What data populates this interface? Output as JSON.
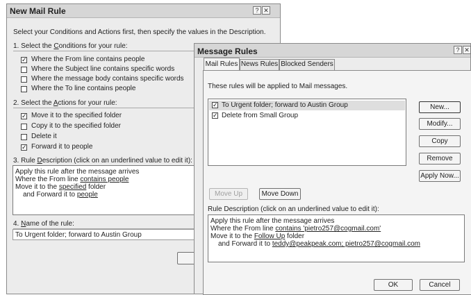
{
  "new_rule": {
    "title": "New Mail Rule",
    "instruction": "Select your Conditions and Actions first, then specify the values in the Description.",
    "step1": {
      "pre": "1. Select the ",
      "u": "C",
      "post": "onditions for your rule:"
    },
    "conditions": [
      {
        "label": "Where the From line contains people",
        "checked": true
      },
      {
        "label": "Where the Subject line contains specific words",
        "checked": false
      },
      {
        "label": "Where the message body contains specific words",
        "checked": false
      },
      {
        "label": "Where the To line contains people",
        "checked": false
      }
    ],
    "step2": {
      "pre": "2. Select the ",
      "u": "A",
      "post": "ctions for your rule:"
    },
    "actions": [
      {
        "label": "Move it to the specified folder",
        "checked": true
      },
      {
        "label": "Copy it to the specified folder",
        "checked": false
      },
      {
        "label": "Delete it",
        "checked": false
      },
      {
        "label": "Forward it to people",
        "checked": true
      }
    ],
    "step3": {
      "pre": "3. Rule ",
      "u": "D",
      "post": "escription (click on an underlined value to edit it):"
    },
    "desc_lines": {
      "l1": "Apply this rule after the message arrives",
      "l2a": "Where the From line ",
      "l2b": "contains people",
      "l3a": "Move it to the ",
      "l3b": "specified",
      "l3c": " folder",
      "l4a": "and Forward it to ",
      "l4b": "people"
    },
    "step4": {
      "pre": "4. ",
      "u": "N",
      "post": "ame of the rule:"
    },
    "rule_name": "To Urgent folder; forward to Austin Group"
  },
  "rules": {
    "title": "Message Rules",
    "tabs": [
      "Mail Rules",
      "News Rules",
      "Blocked Senders"
    ],
    "intro": "These rules will be applied to Mail messages.",
    "items": [
      {
        "label": "To Urgent folder; forward to Austin Group",
        "checked": true
      },
      {
        "label": "Delete from Small Group",
        "checked": true
      }
    ],
    "buttons": {
      "new": "New...",
      "modify": "Modify...",
      "copy": "Copy",
      "remove": "Remove",
      "apply": "Apply Now..."
    },
    "move_up": "Move Up",
    "move_down": "Move Down",
    "desc_label": "Rule Description (click on an underlined value to edit it):",
    "desc": {
      "l1": "Apply this rule after the message arrives",
      "l2a": "Where the From line ",
      "l2b": "contains 'pietro257@cogmail.com'",
      "l3a": "Move it to the ",
      "l3b": "Follow Up",
      "l3c": " folder",
      "l4a": "and Forward it to ",
      "l4b": "teddy@peakpeak.com; pietro257@cogmail.com"
    },
    "ok": "OK",
    "cancel": "Cancel"
  }
}
